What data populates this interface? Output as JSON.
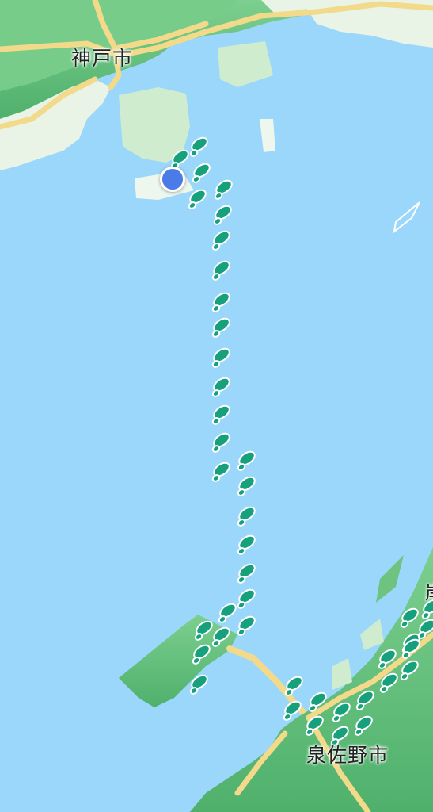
{
  "map": {
    "colors": {
      "water": "#9ad7fb",
      "land_green": "#5fbf7a",
      "land_light": "#bfe6c1",
      "urban": "#e9f3e6",
      "road": "#f3d98a",
      "footprint": "#16a07c",
      "location_dot": "#4a7be6"
    },
    "labels": {
      "kobe": "神戸市",
      "izumisano": "泉佐野市",
      "partial_edge": "岸"
    },
    "icons": {
      "footprint": "footprints-icon",
      "current_location": "current-location-dot"
    },
    "route": {
      "description_icon": "walking-footprints-trail"
    }
  }
}
